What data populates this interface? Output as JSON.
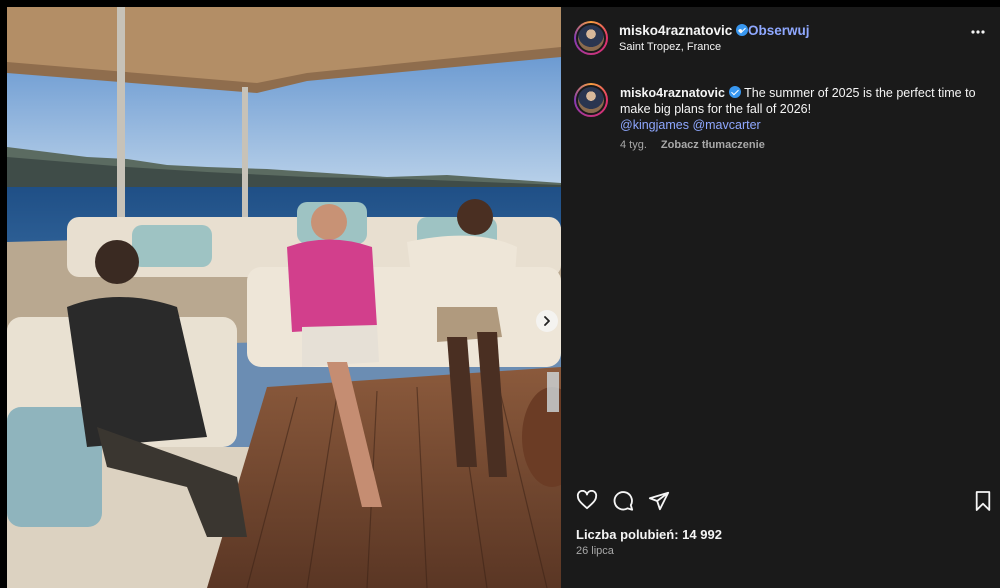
{
  "post": {
    "username": "misko4raznatovic",
    "dot": "•",
    "follow_label": "Obserwuj",
    "location": "Saint Tropez, France",
    "more_icon": "more-horizontal-icon",
    "caption_user": "misko4raznatovic",
    "caption_text": "The summer of 2025 is the perfect time to make big plans for the fall of 2026!",
    "mentions": [
      "@kingjames",
      "@mavcarter"
    ],
    "age": "4 tyg.",
    "translate_label": "Zobacz tłumaczenie",
    "likes_label": "Liczba polubień: 14 992",
    "date": "26 lipca"
  },
  "icons": {
    "like": "heart-icon",
    "comment": "comment-icon",
    "share": "share-icon",
    "save": "bookmark-icon",
    "next": "chevron-right-icon",
    "verified": "verified-badge-icon"
  },
  "colors": {
    "panel_bg": "#1a1a1a",
    "link": "#8fa8ff",
    "verified": "#3897f0",
    "muted": "#a8a8a8"
  }
}
